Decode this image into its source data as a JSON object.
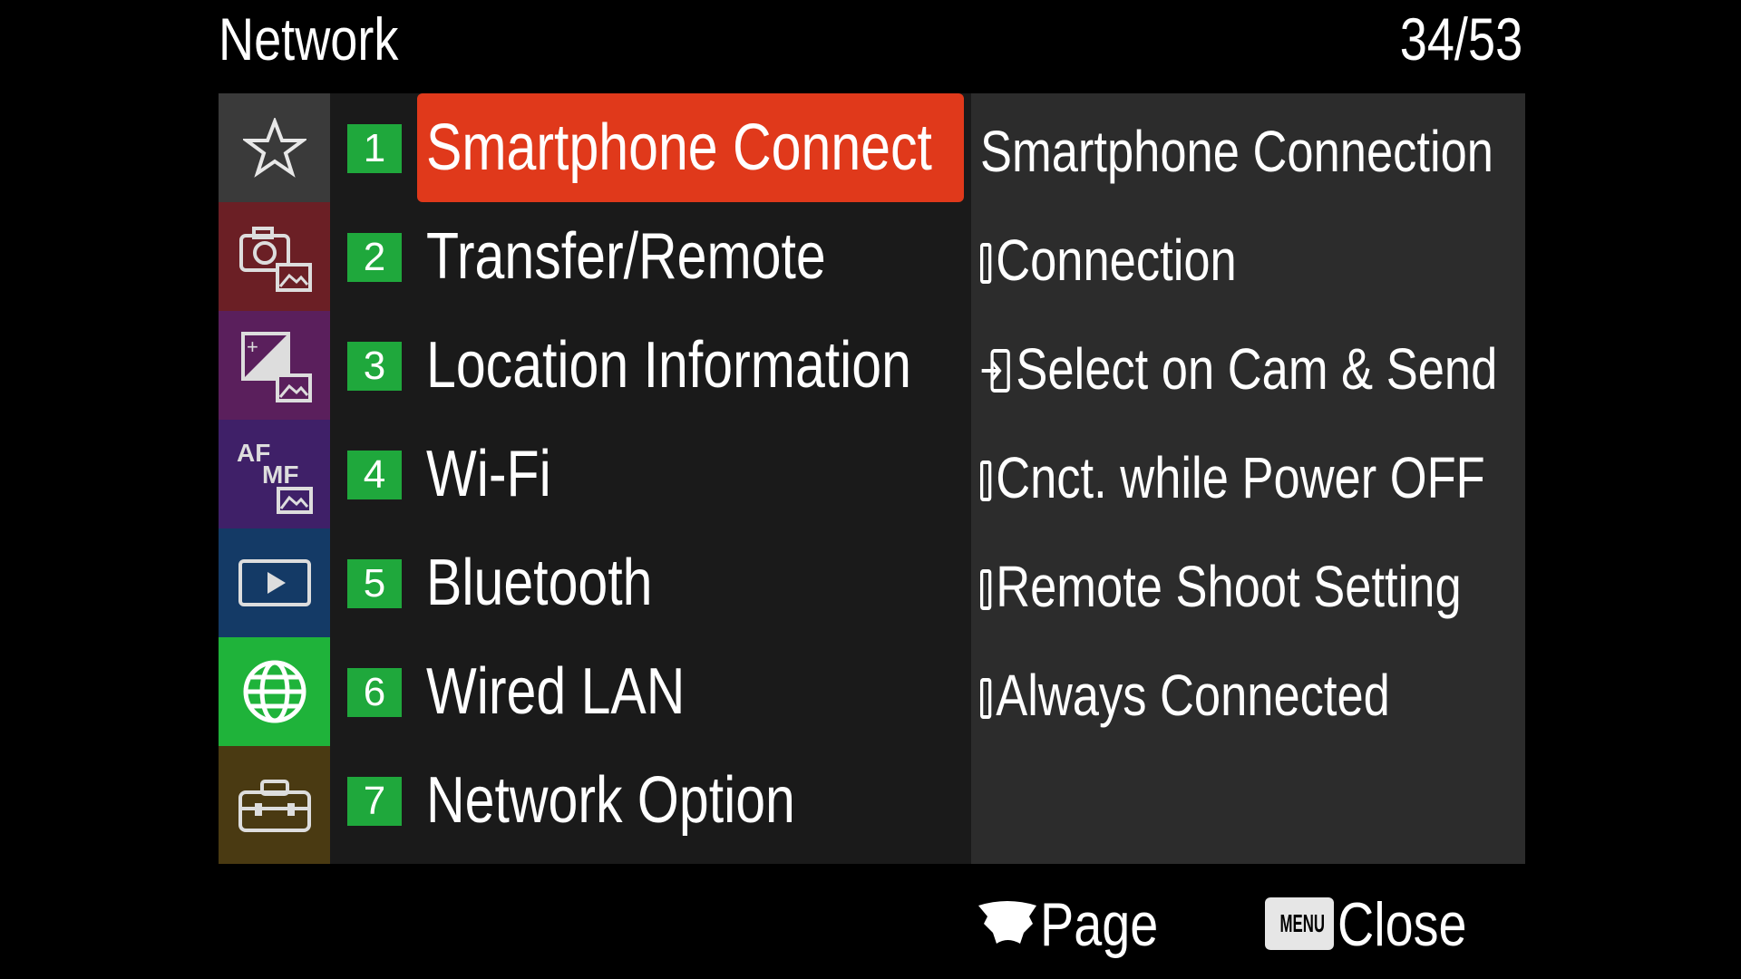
{
  "header": {
    "title": "Network",
    "page_counter": "34/53"
  },
  "categories": [
    {
      "name": "favorites",
      "icon": "star-icon",
      "color": "#3a3a3a",
      "active": false
    },
    {
      "name": "shooting",
      "icon": "camera-image-icon",
      "color": "#6b1f25",
      "active": false
    },
    {
      "name": "exposure",
      "icon": "exposure-image-icon",
      "color": "#5a1f5c",
      "active": false
    },
    {
      "name": "focus",
      "icon": "af-mf-image-icon",
      "color": "#3f2068",
      "active": false
    },
    {
      "name": "playback",
      "icon": "playback-icon",
      "color": "#143a66",
      "active": false
    },
    {
      "name": "network",
      "icon": "globe-icon",
      "color": "#1fb33a",
      "active": true
    },
    {
      "name": "setup",
      "icon": "toolbox-icon",
      "color": "#4a3a12",
      "active": false
    }
  ],
  "menu": {
    "selected_index": 0,
    "items": [
      {
        "number": "1",
        "label": "Smartphone Connect"
      },
      {
        "number": "2",
        "label": "Transfer/Remote"
      },
      {
        "number": "3",
        "label": "Location Information"
      },
      {
        "number": "4",
        "label": "Wi-Fi"
      },
      {
        "number": "5",
        "label": "Bluetooth"
      },
      {
        "number": "6",
        "label": "Wired LAN"
      },
      {
        "number": "7",
        "label": "Network Option"
      }
    ]
  },
  "sub_items": [
    {
      "label": "Smartphone Connection",
      "icon": ""
    },
    {
      "label": "Connection",
      "icon": "phone-icon"
    },
    {
      "label": "Select on Cam & Send",
      "icon": "send-icon"
    },
    {
      "label": "Cnct. while Power OFF",
      "icon": "phone-icon"
    },
    {
      "label": "Remote Shoot Setting",
      "icon": "phone-icon"
    },
    {
      "label": "Always Connected",
      "icon": "phone-icon"
    }
  ],
  "footer": {
    "page_label": "Page",
    "close_key": "MENU",
    "close_label": "Close"
  },
  "colors": {
    "highlight": "#e0391b",
    "badge": "#1fa83c",
    "active_tab": "#1fb33a"
  }
}
